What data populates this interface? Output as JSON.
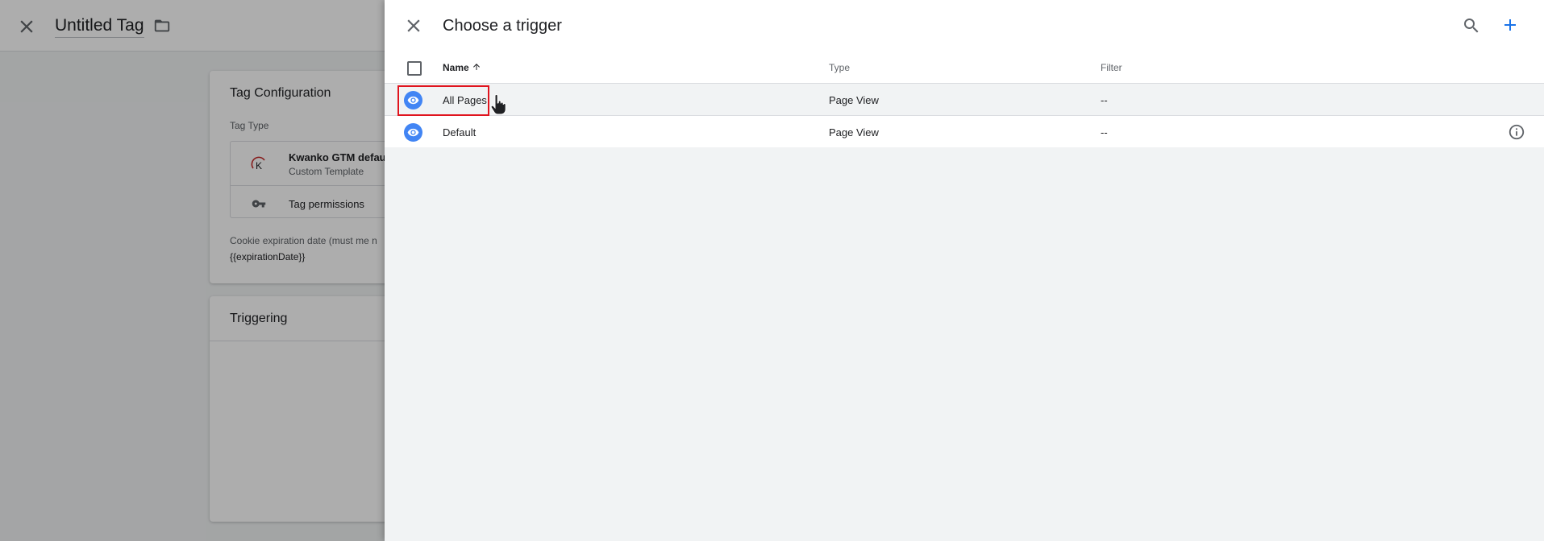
{
  "background": {
    "title": "Untitled Tag",
    "tag_configuration": {
      "heading": "Tag Configuration",
      "tag_type_label": "Tag Type",
      "template_name": "Kwanko GTM default",
      "template_kind": "Custom Template",
      "permissions_label": "Tag permissions",
      "cookie_label": "Cookie expiration date (must me n",
      "cookie_value": "{{expirationDate}}"
    },
    "triggering": {
      "heading": "Triggering"
    }
  },
  "drawer": {
    "title": "Choose a trigger",
    "columns": {
      "name": "Name",
      "type": "Type",
      "filter": "Filter"
    },
    "rows": [
      {
        "name": "All Pages",
        "type": "Page View",
        "filter": "--"
      },
      {
        "name": "Default",
        "type": "Page View",
        "filter": "--"
      }
    ]
  },
  "colors": {
    "accent": "#1a73e8",
    "eye_badge": "#4285f4",
    "highlight": "#e0141e"
  },
  "icons": [
    "close-icon",
    "folder-icon",
    "search-icon",
    "add-icon",
    "eye-icon",
    "info-icon",
    "key-icon",
    "arrow-up-icon"
  ]
}
